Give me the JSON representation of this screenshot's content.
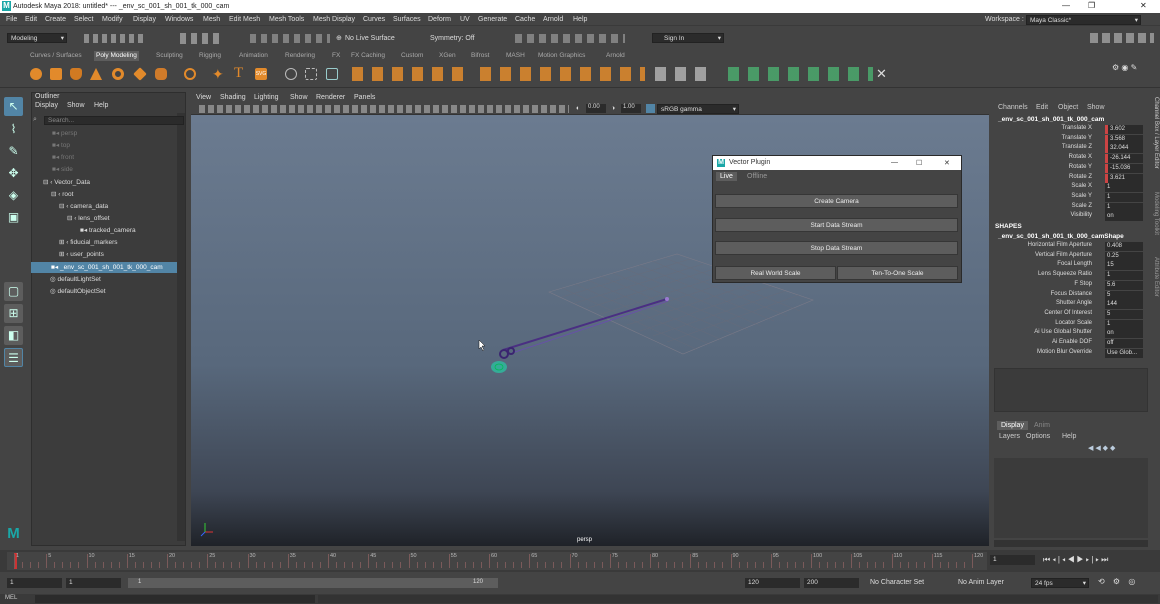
{
  "window": {
    "title": "Autodesk Maya 2018: untitled*   ---   _env_sc_001_sh_001_tk_000_cam"
  },
  "menubar": {
    "items": [
      "File",
      "Edit",
      "Create",
      "Select",
      "Modify",
      "Display",
      "Windows",
      "Mesh",
      "Edit Mesh",
      "Mesh Tools",
      "Mesh Display",
      "Curves",
      "Surfaces",
      "Deform",
      "UV",
      "Generate",
      "Cache",
      "Arnold",
      "Help"
    ],
    "workspace_label": "Workspace :",
    "workspace_value": "Maya Classic*"
  },
  "status": {
    "mode": "Modeling",
    "live_surface": "No Live Surface",
    "symmetry": "Symmetry: Off",
    "sign_in": "Sign In"
  },
  "shelf_tabs": [
    "Curves / Surfaces",
    "Poly Modeling",
    "Sculpting",
    "Rigging",
    "Animation",
    "Rendering",
    "FX",
    "FX Caching",
    "Custom",
    "XGen",
    "Bifrost",
    "MASH",
    "Motion Graphics",
    "Arnold"
  ],
  "shelf_active": "Poly Modeling",
  "outliner": {
    "title": "Outliner",
    "menu": [
      "Display",
      "Show",
      "Help"
    ],
    "search_placeholder": "Search...",
    "items": [
      "persp",
      "top",
      "front",
      "side",
      "Vector_Data",
      "root",
      "camera_data",
      "lens_offset",
      "tracked_camera",
      "fiducial_markers",
      "user_points",
      "_env_sc_001_sh_001_tk_000_cam",
      "defaultLightSet",
      "defaultObjectSet"
    ]
  },
  "viewport": {
    "menu": [
      "View",
      "Shading",
      "Lighting",
      "Show",
      "Renderer",
      "Panels"
    ],
    "exposure": "0.00",
    "gamma": "1.00",
    "color_space": "sRGB gamma",
    "camera_label": "persp"
  },
  "plugin": {
    "title": "Vector Plugin",
    "tabs": [
      "Live",
      "Offline"
    ],
    "buttons": {
      "create": "Create Camera",
      "start": "Start Data Stream",
      "stop": "Stop Data Stream",
      "real": "Real World Scale",
      "ten": "Ten-To-One Scale"
    }
  },
  "channel_box": {
    "menu": [
      "Channels",
      "Edit",
      "Object",
      "Show"
    ],
    "object_name": "_env_sc_001_sh_001_tk_000_cam",
    "channels": [
      {
        "label": "Translate X",
        "value": "3.602"
      },
      {
        "label": "Translate Y",
        "value": "3.568"
      },
      {
        "label": "Translate Z",
        "value": "32.044"
      },
      {
        "label": "Rotate X",
        "value": "-26.144"
      },
      {
        "label": "Rotate Y",
        "value": "-15.036"
      },
      {
        "label": "Rotate Z",
        "value": "3.621"
      },
      {
        "label": "Scale X",
        "value": "1"
      },
      {
        "label": "Scale Y",
        "value": "1"
      },
      {
        "label": "Scale Z",
        "value": "1"
      },
      {
        "label": "Visibility",
        "value": "on"
      }
    ],
    "shapes_label": "SHAPES",
    "shape_name": "_env_sc_001_sh_001_tk_000_camShape",
    "shape_channels": [
      {
        "label": "Horizontal Film Aperture",
        "value": "0.408"
      },
      {
        "label": "Vertical Film Aperture",
        "value": "0.25"
      },
      {
        "label": "Focal Length",
        "value": "15"
      },
      {
        "label": "Lens Squeeze Ratio",
        "value": "1"
      },
      {
        "label": "F Stop",
        "value": "5.6"
      },
      {
        "label": "Focus Distance",
        "value": "5"
      },
      {
        "label": "Shutter Angle",
        "value": "144"
      },
      {
        "label": "Center Of Interest",
        "value": "5"
      },
      {
        "label": "Locator Scale",
        "value": "1"
      },
      {
        "label": "Ai Use Global Shutter",
        "value": "on"
      },
      {
        "label": "Ai Enable DOF",
        "value": "off"
      },
      {
        "label": "Motion Blur Override",
        "value": "Use Glob..."
      }
    ],
    "layer_tabs": [
      "Display",
      "Anim"
    ],
    "layer_menu": [
      "Layers",
      "Options",
      "Help"
    ],
    "side_tabs": [
      "Channel Box / Layer Editor",
      "Modeling Toolkit",
      "Attribute Editor"
    ]
  },
  "timeline": {
    "ticks": [
      "1",
      "5",
      "10",
      "15",
      "20",
      "25",
      "30",
      "35",
      "40",
      "45",
      "50",
      "55",
      "60",
      "65",
      "70",
      "75",
      "80",
      "85",
      "90",
      "95",
      "100",
      "105",
      "110",
      "115",
      "120"
    ],
    "current_frame": "1"
  },
  "range": {
    "start": "1",
    "anim_start": "1",
    "inner_start": "1",
    "inner_end": "120",
    "end": "120",
    "anim_end": "200",
    "character_set": "No Character Set",
    "anim_layer": "No Anim Layer",
    "fps": "24 fps"
  },
  "command": {
    "mel": "MEL"
  },
  "colors": {
    "accent": "#5285a6",
    "maya_teal": "#1aa7a7",
    "shelf_orange": "#e28a2b",
    "shelf_green": "#4aa36b"
  }
}
